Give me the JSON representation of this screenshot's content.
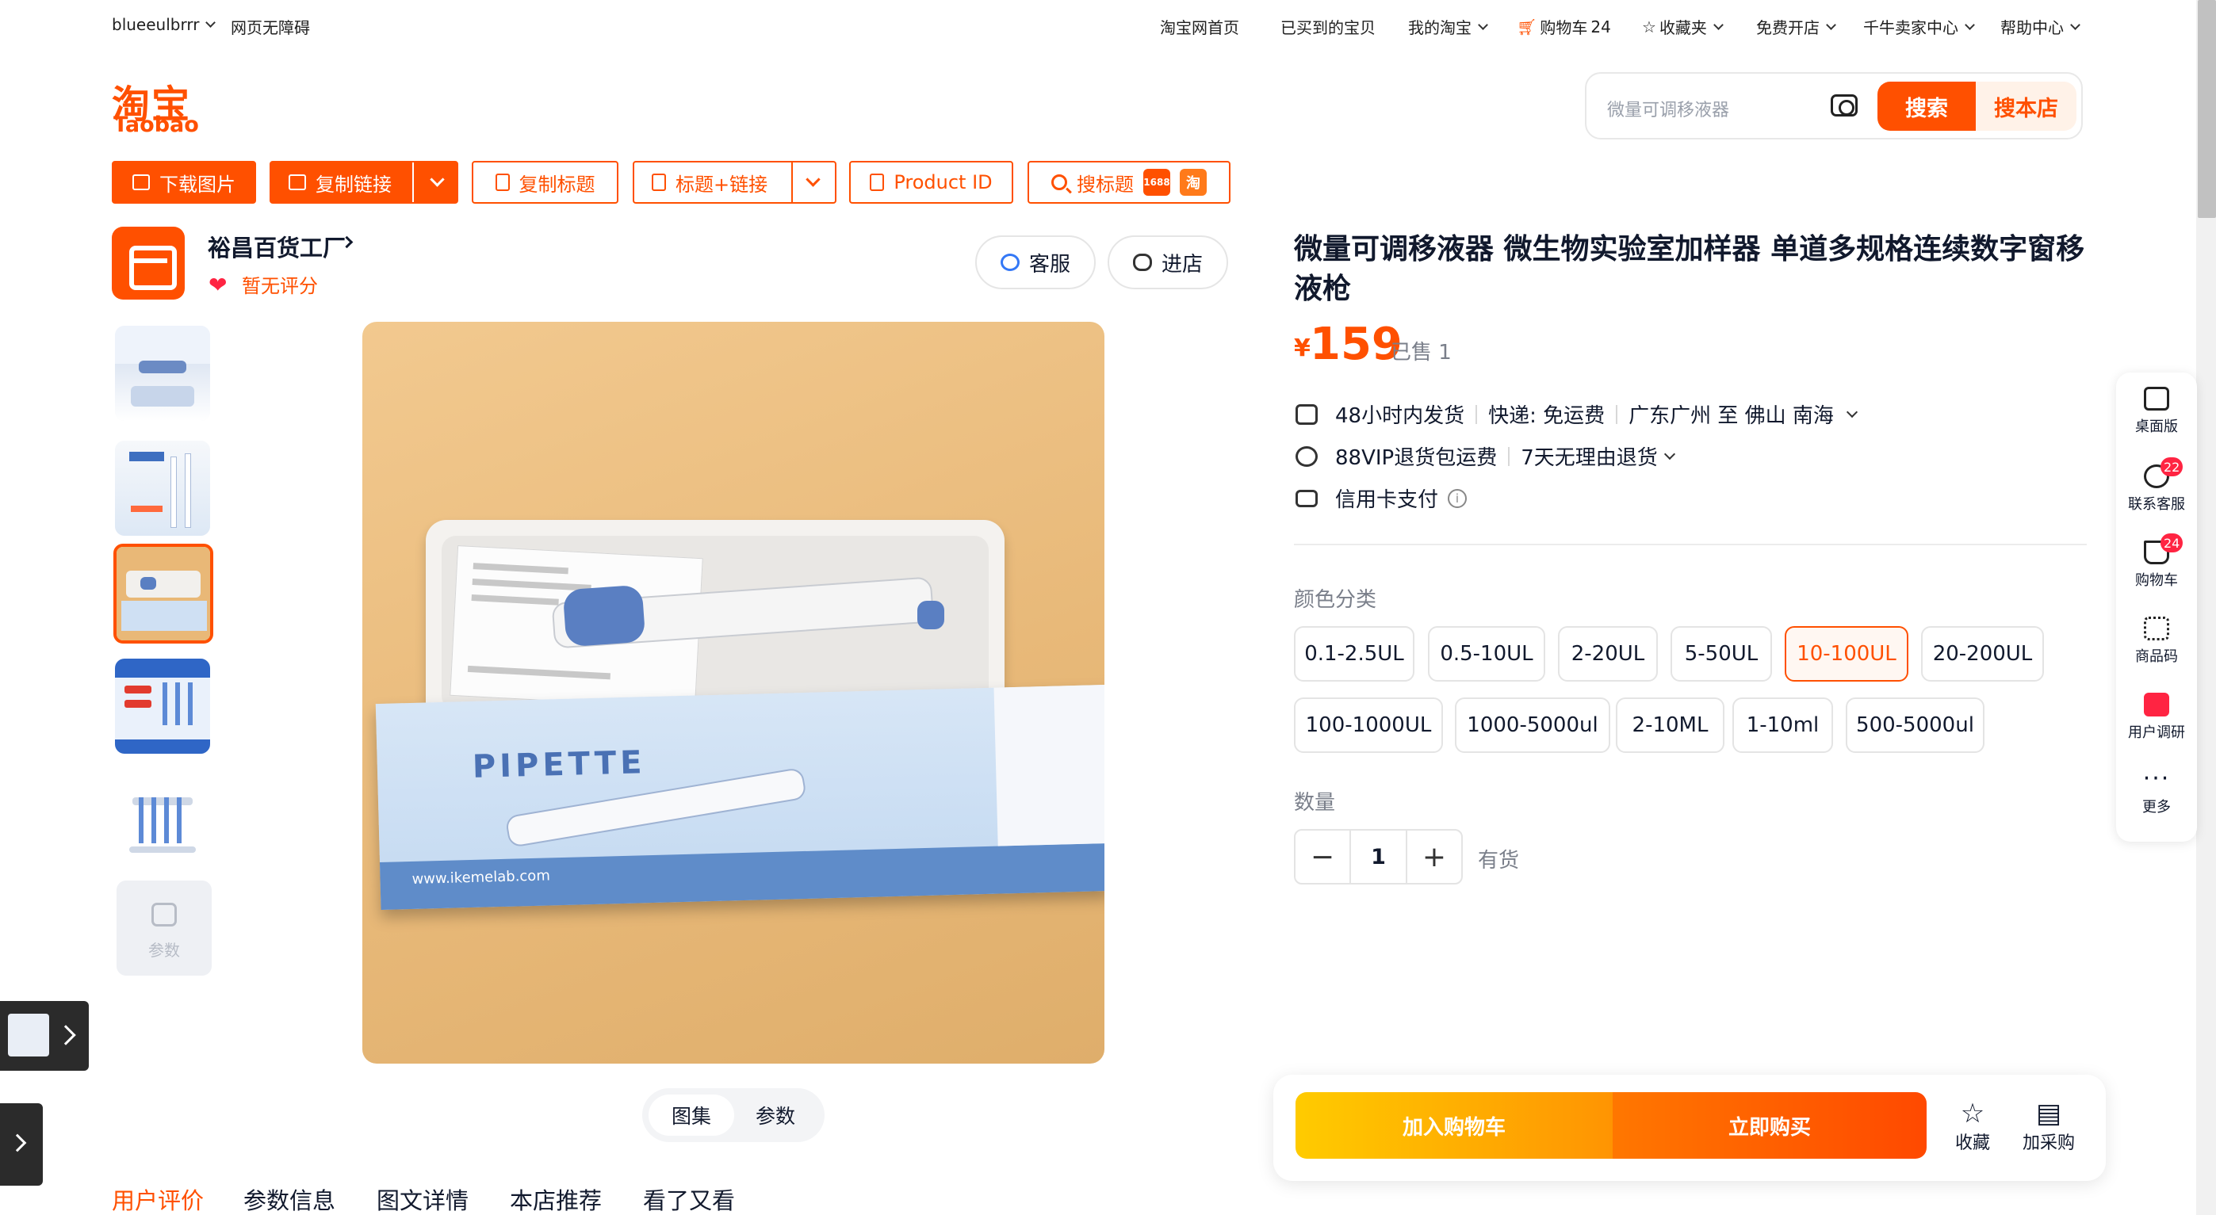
{
  "topbar": {
    "username": "blueeulbrrr",
    "accessibility": "网页无障碍",
    "home": "淘宝网首页",
    "bought": "已买到的宝贝",
    "my_taobao": "我的淘宝",
    "cart": "购物车",
    "cart_count": "24",
    "favorites": "收藏夹",
    "open_shop": "免费开店",
    "seller_center": "千牛卖家中心",
    "help": "帮助中心"
  },
  "logo": {
    "cn": "淘宝",
    "en": "Taobao"
  },
  "search": {
    "placeholder": "微量可调移液器",
    "search_label": "搜索",
    "search_store_label": "搜本店"
  },
  "toolbar": {
    "download_images": "下载图片",
    "copy_link": "复制链接",
    "copy_title": "复制标题",
    "title_link": "标题+链接",
    "product_id": "Product ID",
    "search_title": "搜标题",
    "badge_1688": "1688",
    "badge_tao": "淘"
  },
  "shop": {
    "name": "裕昌百货工厂",
    "rating": "暂无评分",
    "service": "客服",
    "enter": "进店"
  },
  "gallery": {
    "params_label": "参数",
    "selected_index": 3,
    "box_brand": "PIPETTE",
    "box_url": "www.ikemelab.com"
  },
  "image_tabs": {
    "gallery": "图集",
    "params": "参数"
  },
  "bottom_nav": [
    "用户评价",
    "参数信息",
    "图文详情",
    "本店推荐",
    "看了又看"
  ],
  "product": {
    "title": "微量可调移液器 微生物实验室加样器 单道多规格连续数字窗移液枪",
    "currency": "¥",
    "price": "159",
    "sold": "已售 1",
    "shipping_time": "48小时内发货",
    "express": "快递: 免运费",
    "route": "广东广州 至 佛山 南海",
    "vip": "88VIP退货包运费",
    "return_policy": "7天无理由退货",
    "credit": "信用卡支付",
    "info_i": "i"
  },
  "variants": {
    "label": "颜色分类",
    "options": [
      "0.1-2.5UL",
      "0.5-10UL",
      "2-20UL",
      "5-50UL",
      "10-100UL",
      "20-200UL",
      "100-1000UL",
      "1000-5000ul",
      "2-10ML",
      "1-10ml",
      "500-5000ul"
    ],
    "selected": "10-100UL"
  },
  "quantity": {
    "label": "数量",
    "value": "1",
    "minus": "−",
    "plus": "+",
    "stock": "有货"
  },
  "buybar": {
    "add_cart": "加入购物车",
    "buy_now": "立即购买",
    "favorite": "收藏",
    "purchase_list": "加采购"
  },
  "sidebar": {
    "desktop": "桌面版",
    "contact": "联系客服",
    "contact_badge": "22",
    "cart": "购物车",
    "cart_badge": "24",
    "qrcode": "商品码",
    "survey": "用户调研",
    "more": "更多",
    "more_glyph": "···"
  },
  "colors": {
    "accent": "#ff5000",
    "buy_gradient_start": "#ffcb00",
    "text": "#11192d",
    "muted": "#7a7f8a"
  }
}
